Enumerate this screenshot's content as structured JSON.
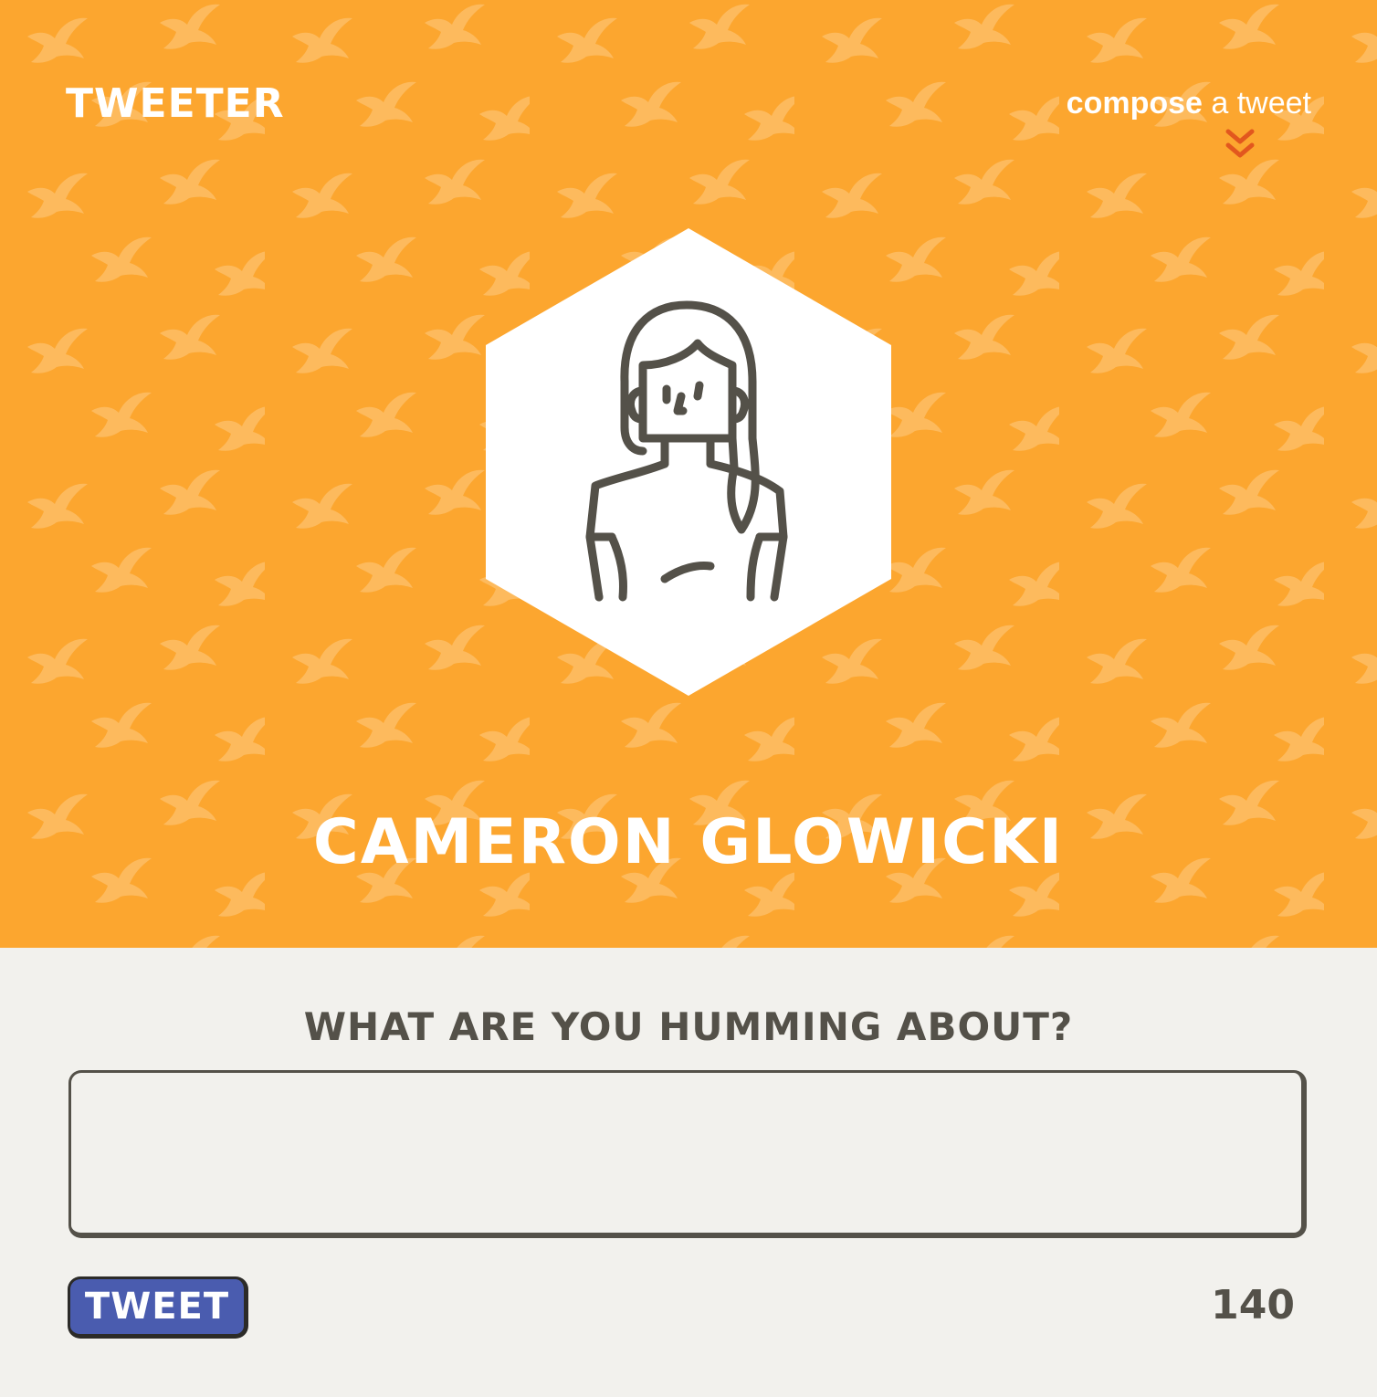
{
  "header": {
    "brand": "TWEETER",
    "compose_bold": "compose",
    "compose_rest": " a tweet",
    "compose_icon": "double-chevron-down-icon"
  },
  "profile": {
    "avatar_icon": "woman-avatar-icon",
    "name": "CAMERON GLOWICKI"
  },
  "composer": {
    "prompt": "WHAT ARE YOU HUMMING ABOUT?",
    "input_value": "",
    "tweet_button_label": "TWEET",
    "char_count": "140"
  },
  "colors": {
    "hero_bg": "#fca62f",
    "composer_bg": "#f2f1ed",
    "text_dark": "#545149",
    "button_bg": "#4a5caf",
    "arrow_accent": "#e2571e"
  }
}
